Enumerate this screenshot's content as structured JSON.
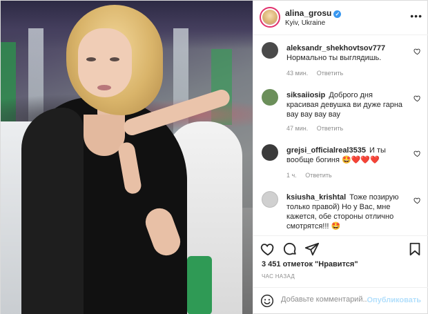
{
  "post": {
    "username": "alina_grosu",
    "location": "Kyiv, Ukraine",
    "verified_glyph": "✓",
    "more_glyph": "•••"
  },
  "comments": [
    {
      "user": "aleksandr_shekhovtsov777",
      "text": "Нормально ты выглядишь.",
      "time": "43 мин.",
      "reply": "Ответить",
      "avatar_color": "#4a4a4a"
    },
    {
      "user": "siksaiiosip",
      "text": "Доброго дня красивая девушка ви дуже гарна вау вау вау вау",
      "time": "47 мин.",
      "reply": "Ответить",
      "avatar_color": "#6b8f5a"
    },
    {
      "user": "grejsi_officialreal3535",
      "text": "И ты вообще богиня 🤩❤️❤️❤️",
      "time": "1 ч.",
      "reply": "Ответить",
      "avatar_color": "#3b3b3b"
    },
    {
      "user": "ksiusha_krishtal",
      "text": "Тоже позирую только правой) Но у Вас, мне кажется, обе стороны отлично смотрятся!!! 🤩",
      "time": "",
      "reply": "",
      "avatar_color": "#c9c9c9"
    }
  ],
  "likes": {
    "text": "3 451 отметок \"Нравится\""
  },
  "timestamp": "ЧАС НАЗАД",
  "add_comment": {
    "placeholder": "Добавьте комментарий...",
    "publish": "Опубликовать"
  },
  "icons": {
    "like": "heart-icon",
    "comment": "comment-icon",
    "share": "share-icon",
    "save": "bookmark-icon",
    "emoji": "smile-icon"
  }
}
